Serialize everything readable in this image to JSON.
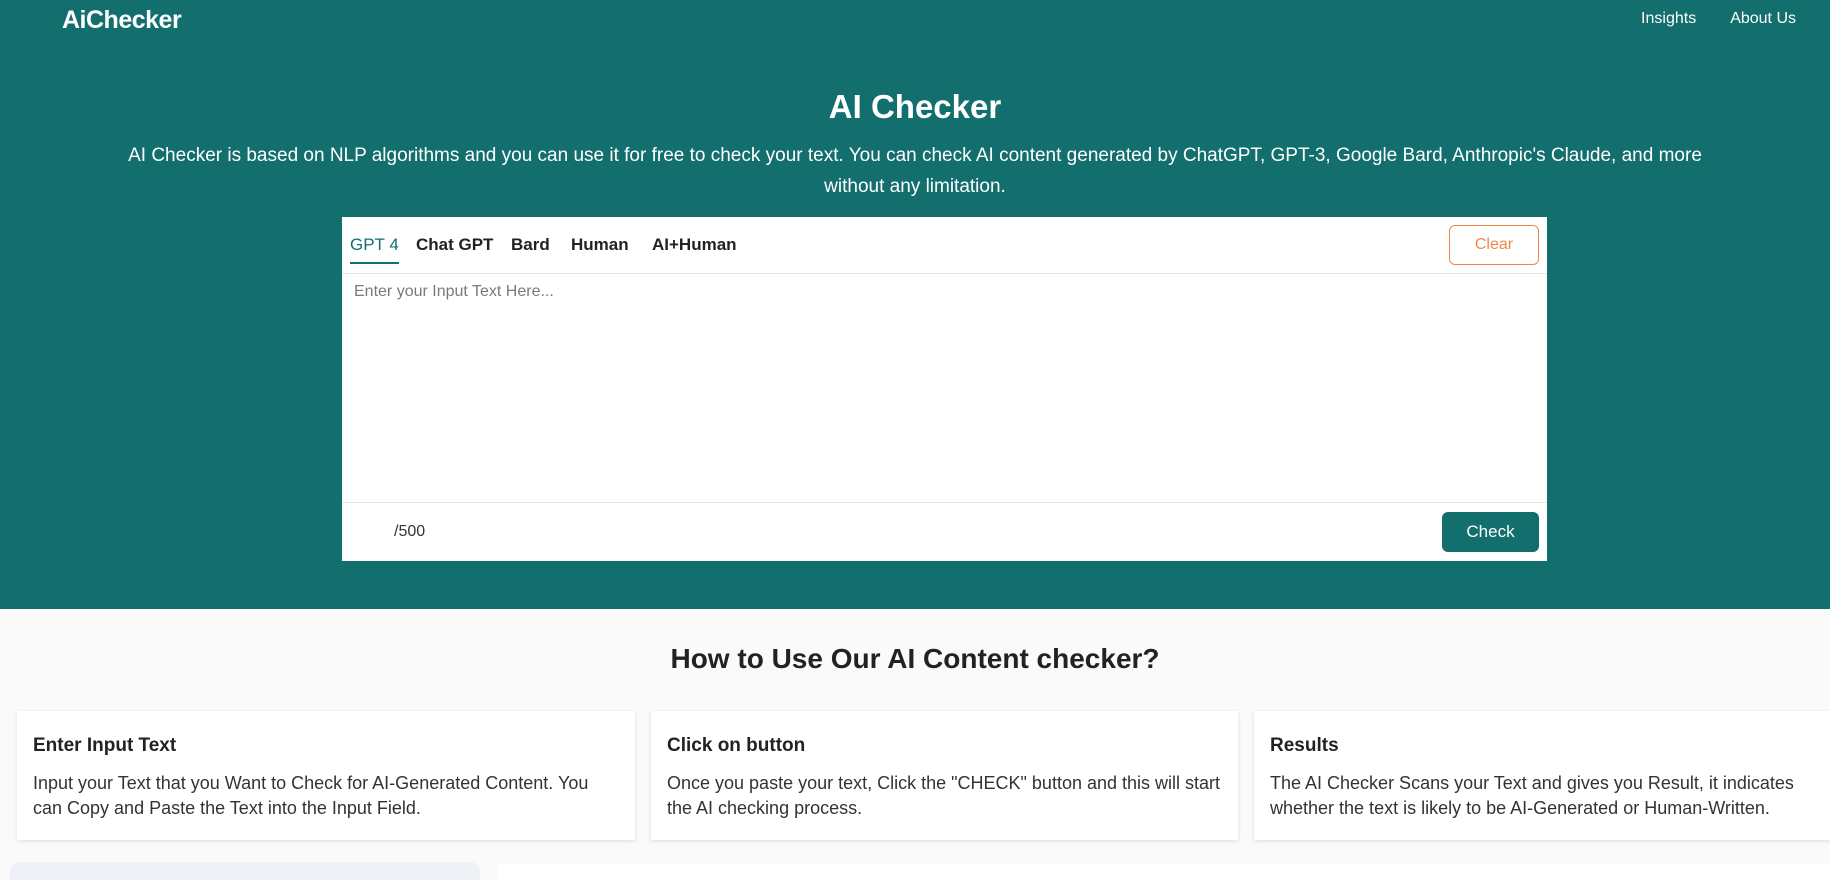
{
  "header": {
    "logo": "AiChecker",
    "nav": [
      "Insights",
      "About Us"
    ]
  },
  "hero": {
    "title": "AI Checker",
    "description": "AI Checker is based on NLP algorithms and you can use it for free to check your text. You can check AI content generated by ChatGPT, GPT-3, Google Bard, Anthropic's Claude, and more without any limitation."
  },
  "checker": {
    "tabs": [
      "GPT 4",
      "Chat GPT",
      "Bard",
      "Human",
      "AI+Human"
    ],
    "active_tab": "GPT 4",
    "clear_label": "Clear",
    "input_value": "",
    "input_placeholder": "Enter your Input Text Here...",
    "counter": "/500",
    "check_label": "Check"
  },
  "how_to": {
    "title": "How to Use Our AI Content checker?",
    "steps": [
      {
        "title": "Enter Input Text",
        "text": "Input your Text that you Want to Check for AI-Generated Content. You can Copy and Paste the Text into the Input Field."
      },
      {
        "title": "Click on button",
        "text": "Once you paste your text, Click the \"CHECK\" button and this will start the AI checking process."
      },
      {
        "title": "Results",
        "text": "The AI Checker Scans your Text and gives you Result, it indicates whether the text is likely to be AI-Generated or Human-Written."
      }
    ]
  },
  "colors": {
    "brand": "#136e6e",
    "accent": "#f0884a",
    "background": "#fafafa"
  }
}
